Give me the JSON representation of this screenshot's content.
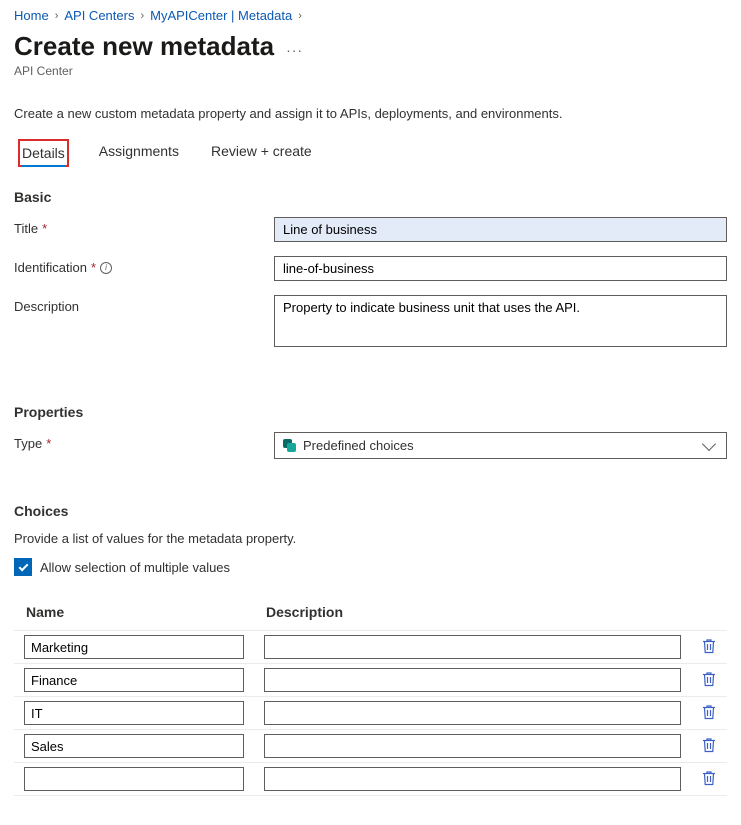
{
  "breadcrumb": {
    "home": "Home",
    "centers": "API Centers",
    "current": "MyAPICenter | Metadata"
  },
  "header": {
    "title": "Create new metadata",
    "subtitle": "API Center",
    "intro": "Create a new custom metadata property and assign it to APIs, deployments, and environments."
  },
  "tabs": {
    "details": "Details",
    "assignments": "Assignments",
    "review": "Review + create"
  },
  "basic": {
    "section": "Basic",
    "title_label": "Title",
    "title_value": "Line of business",
    "ident_label": "Identification",
    "ident_value": "line-of-business",
    "desc_label": "Description",
    "desc_value": "Property to indicate business unit that uses the API."
  },
  "properties": {
    "section": "Properties",
    "type_label": "Type",
    "type_value": "Predefined choices"
  },
  "choices": {
    "section": "Choices",
    "intro": "Provide a list of values for the metadata property.",
    "multi_label": "Allow selection of multiple values",
    "col_name": "Name",
    "col_desc": "Description",
    "rows": [
      {
        "name": "Marketing",
        "desc": ""
      },
      {
        "name": "Finance",
        "desc": ""
      },
      {
        "name": "IT",
        "desc": ""
      },
      {
        "name": "Sales",
        "desc": ""
      },
      {
        "name": "",
        "desc": ""
      }
    ]
  }
}
